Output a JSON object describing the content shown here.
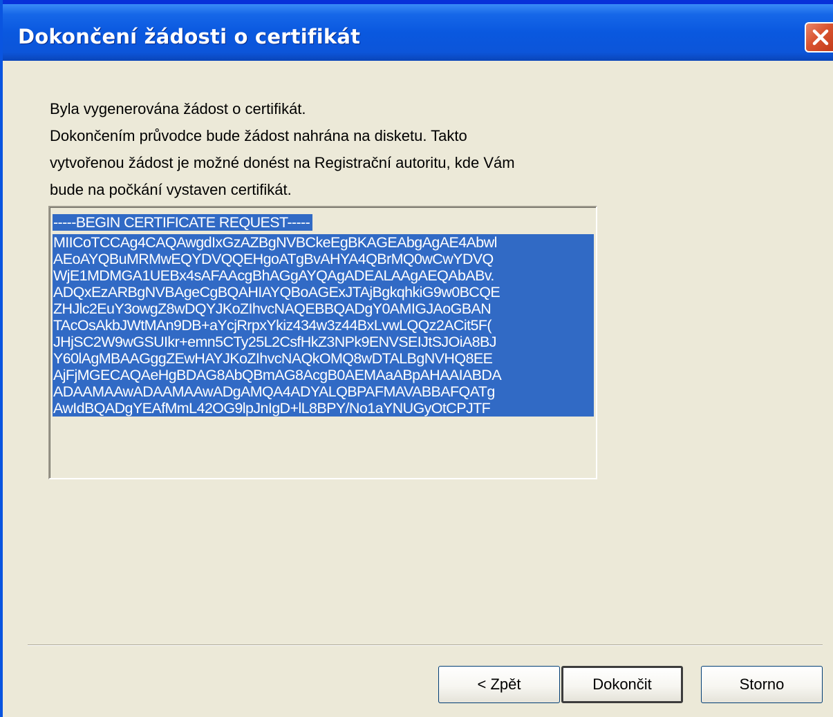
{
  "window": {
    "title": "Dokončení žádosti o certifikát"
  },
  "description": {
    "line1": "Byla vygenerována žádost o certifikát.",
    "line2": "Dokončením průvodce bude žádost nahrána na disketu. Takto",
    "line3": "vytvořenou žádost je možné donést na Registrační autoritu, kde Vám",
    "line4": "bude na počkání vystaven certifikát."
  },
  "certificate": {
    "lines": [
      "-----BEGIN CERTIFICATE REQUEST-----",
      "MIICoTCCAg4CAQAwgdIxGzAZBgNVBCkeEgBKAGEAbgAgAE4Abwl",
      "AEoAYQBuMRMwEQYDVQQEHgoATgBvAHYA4QBrMQ0wCwYDVQ",
      "WjE1MDMGA1UEBx4sAFAAcgBhAGgAYQAgADEALAAgAEQAbABv.",
      "ADQxEzARBgNVBAgeCgBQAHIAYQBoAGExJTAjBgkqhkiG9w0BCQE",
      "ZHJlc2EuY3owgZ8wDQYJKoZIhvcNAQEBBQADgY0AMIGJAoGBAN",
      "TAcOsAkbJWtMAn9DB+aYcjRrpxYkiz434w3z44BxLvwLQQz2ACit5F(",
      "JHjSC2W9wGSUIkr+emn5CTy25L2CsfHkZ3NPk9ENVSEIJtSJOiA8BJ",
      "Y60lAgMBAAGggZEwHAYJKoZIhvcNAQkOMQ8wDTALBgNVHQ8EE",
      "AjFjMGECAQAeHgBDAG8AbQBmAG8AcgB0AEMAaABpAHAAIABDA",
      "ADAAMAAwADAAMAAwADgAMQA4ADYALQBPAFMAVABBAFQATg",
      "AwIdBQADgYEAfMmL42OG9lpJnIgD+lL8BPY/No1aYNUGyOtCPJTF"
    ]
  },
  "buttons": {
    "back": "< Zpět",
    "finish": "Dokončit",
    "cancel": "Storno"
  },
  "colors": {
    "titlebar": "#0a58df",
    "selection": "#316ac5",
    "dialog_bg": "#ece9d8",
    "close_button": "#d9532f"
  },
  "icons": {
    "close": "close-x-icon"
  }
}
